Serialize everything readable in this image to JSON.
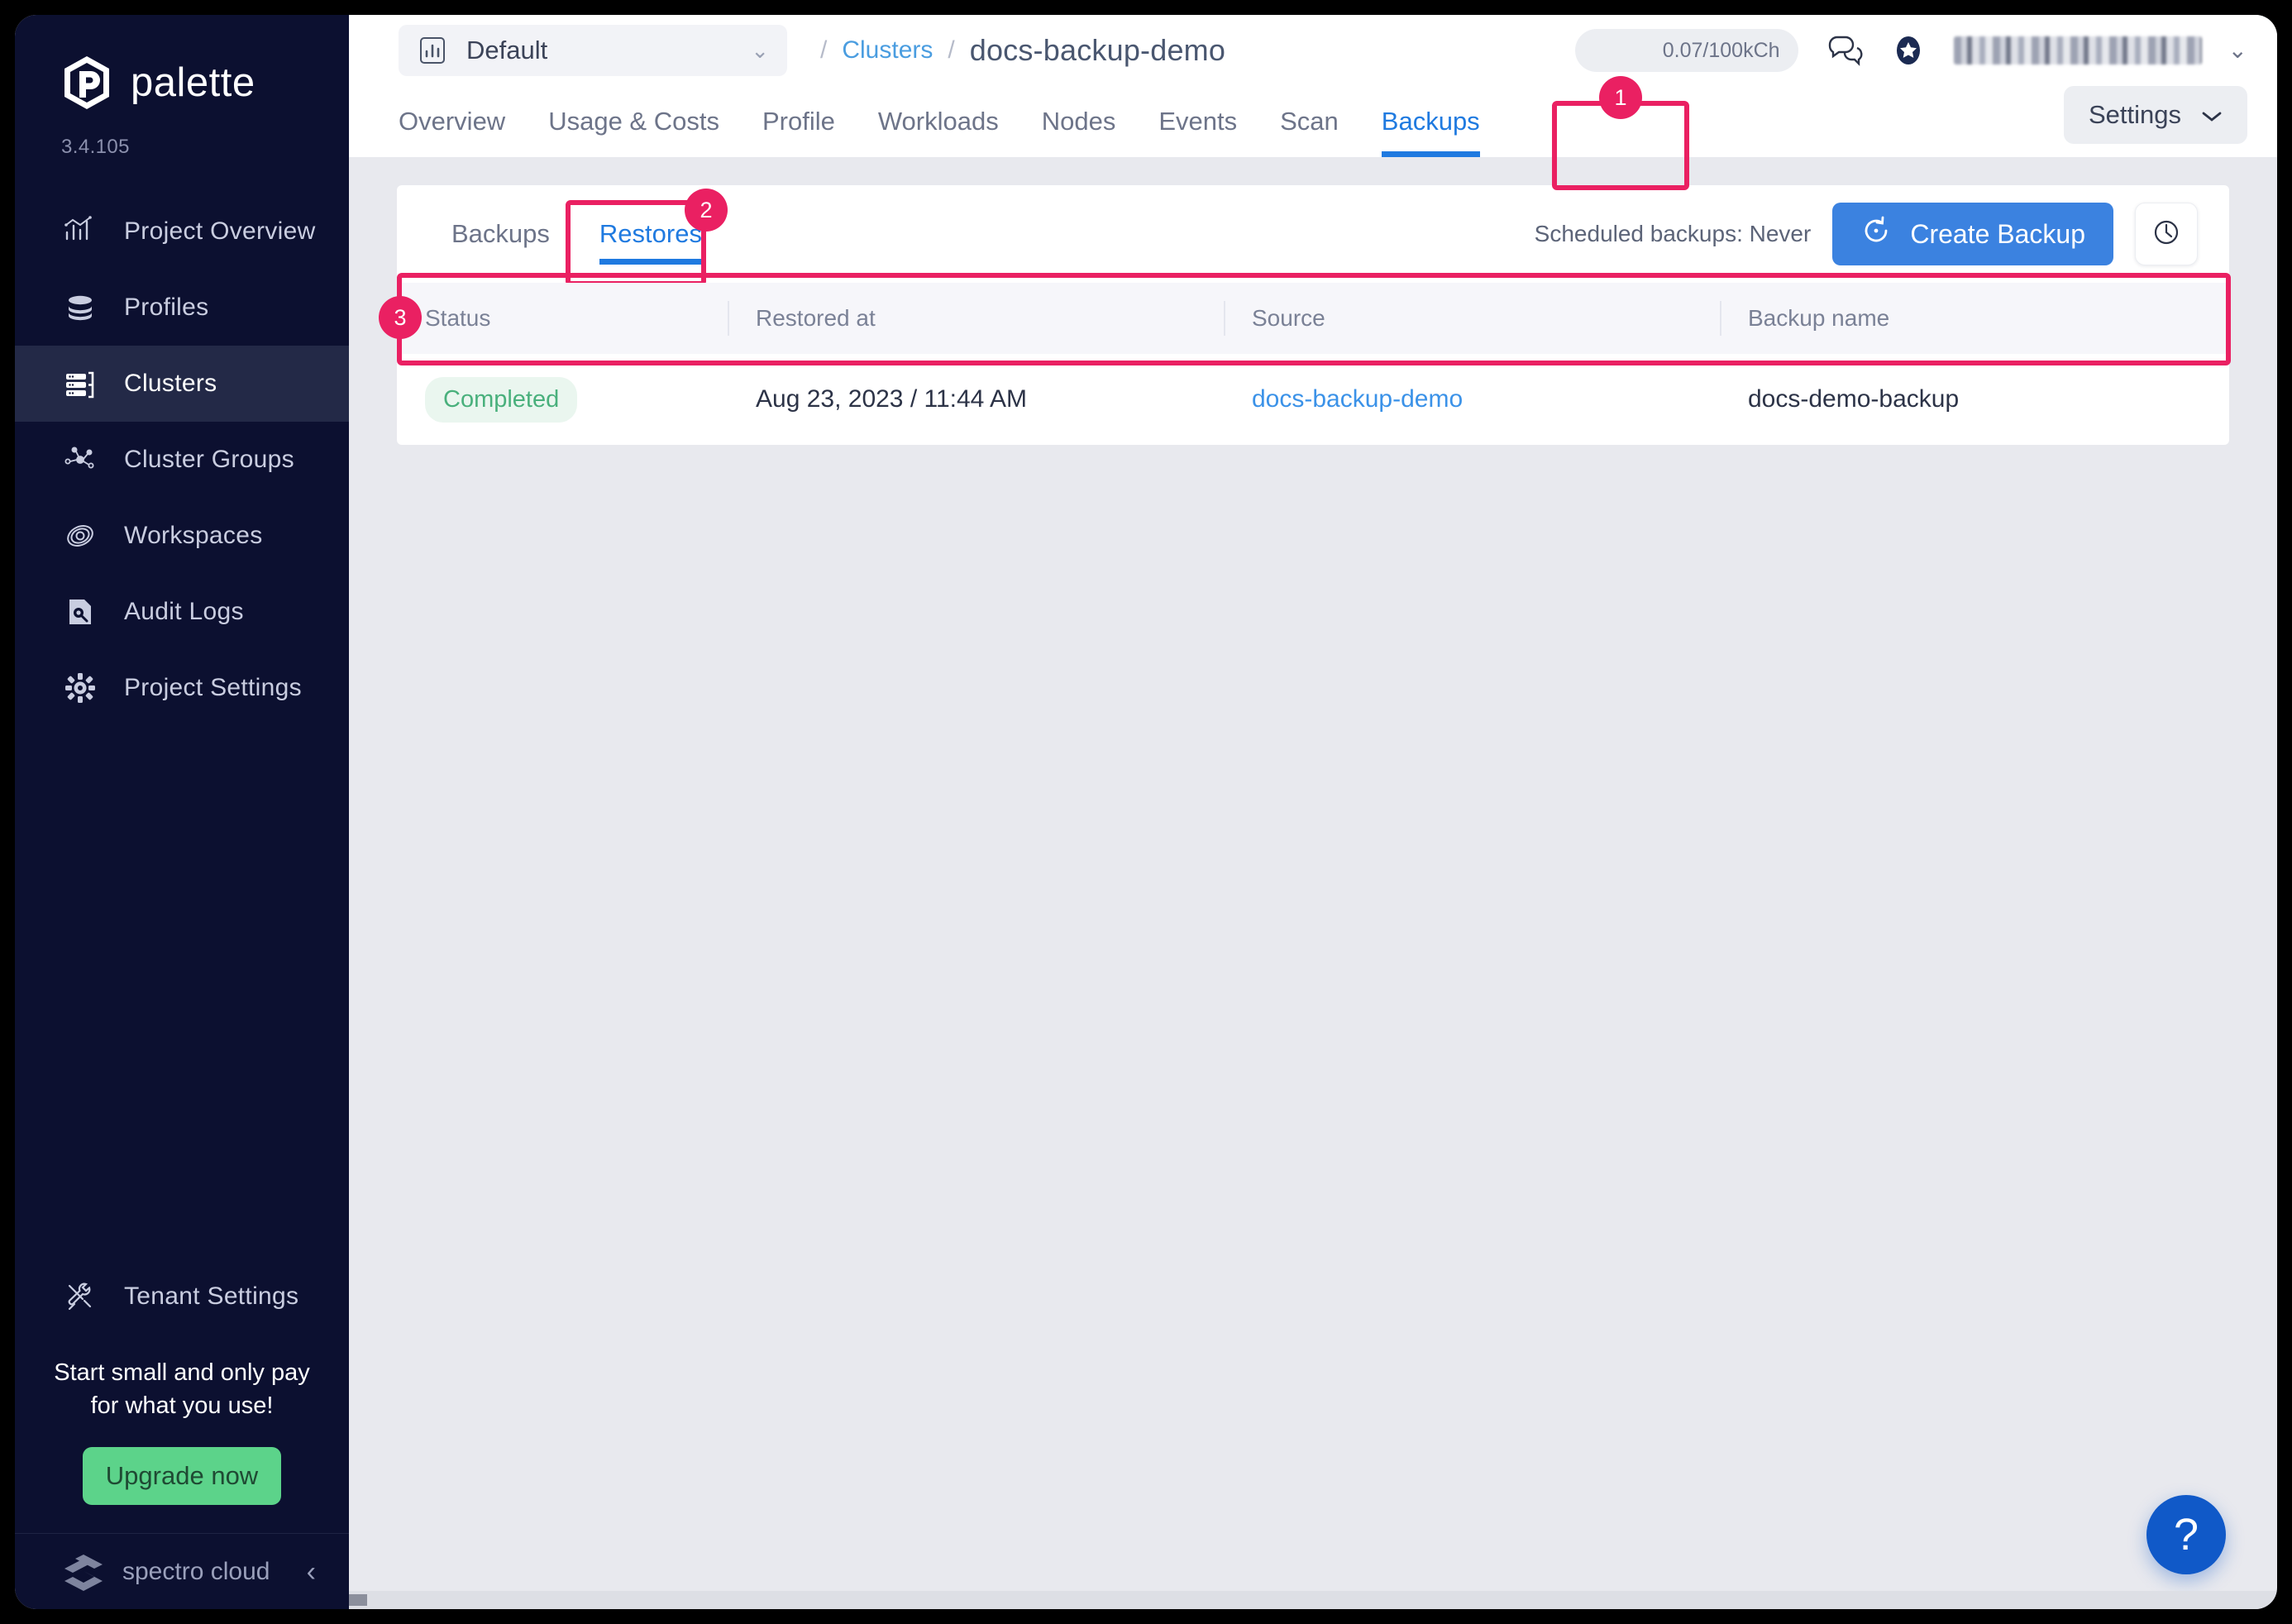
{
  "sidebar": {
    "brand_name": "palette",
    "version": "3.4.105",
    "items": [
      {
        "label": "Project Overview",
        "icon": "chart-icon"
      },
      {
        "label": "Profiles",
        "icon": "layers-icon"
      },
      {
        "label": "Clusters",
        "icon": "server-icon"
      },
      {
        "label": "Cluster Groups",
        "icon": "network-icon"
      },
      {
        "label": "Workspaces",
        "icon": "orbit-icon"
      },
      {
        "label": "Audit Logs",
        "icon": "audit-icon"
      },
      {
        "label": "Project Settings",
        "icon": "gear-icon"
      }
    ],
    "tenant_settings": {
      "label": "Tenant Settings",
      "icon": "tools-icon"
    },
    "promo": {
      "line1": "Start small and only pay",
      "line2": "for what you use!",
      "button": "Upgrade now"
    },
    "footer": {
      "company": "spectro cloud",
      "collapse_icon": "chevron-left-icon"
    }
  },
  "topbar": {
    "project_selector": {
      "label": "Default",
      "icon": "chart-icon",
      "chevron": "chevron-down-icon"
    },
    "breadcrumb": {
      "separator": "/",
      "parent": "Clusters",
      "current": "docs-backup-demo"
    },
    "usage_pill": "0.07/100kCh",
    "chat_icon": "chat-bubbles-icon",
    "badge_icon": "star-badge-icon",
    "user_chevron": "chevron-down-icon",
    "settings_button": {
      "label": "Settings",
      "chevron": "chevron-down-icon"
    }
  },
  "tabs": [
    {
      "label": "Overview",
      "active": false
    },
    {
      "label": "Usage & Costs",
      "active": false
    },
    {
      "label": "Profile",
      "active": false
    },
    {
      "label": "Workloads",
      "active": false
    },
    {
      "label": "Nodes",
      "active": false
    },
    {
      "label": "Events",
      "active": false
    },
    {
      "label": "Scan",
      "active": false
    },
    {
      "label": "Backups",
      "active": true
    }
  ],
  "panel": {
    "subtabs": [
      {
        "label": "Backups",
        "active": false
      },
      {
        "label": "Restores",
        "active": true
      }
    ],
    "scheduled_text": "Scheduled backups: Never",
    "create_button": {
      "label": "Create Backup",
      "icon": "restore-arrow-icon"
    },
    "history_button_icon": "clock-icon",
    "table": {
      "columns": [
        "Status",
        "Restored at",
        "Source",
        "Backup name"
      ],
      "rows": [
        {
          "status": "Completed",
          "restored_at": "Aug 23, 2023 / 11:44 AM",
          "source": "docs-backup-demo",
          "backup_name": "docs-demo-backup"
        }
      ]
    }
  },
  "annotations": [
    {
      "number": "1",
      "target": "backups-tab"
    },
    {
      "number": "2",
      "target": "restores-subtab"
    },
    {
      "number": "3",
      "target": "restore-row"
    }
  ],
  "help_fab": {
    "glyph": "?",
    "icon": "question-mark-icon"
  },
  "colors": {
    "accent_pink": "#ea2062",
    "link_blue": "#3b92e8",
    "primary_blue": "#3b82e0",
    "sidebar_navy": "#0c1030",
    "success_green": "#49b07c",
    "upgrade_green": "#5cd38a"
  }
}
